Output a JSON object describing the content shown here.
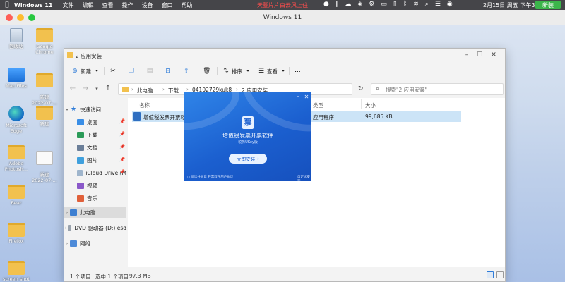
{
  "menubar": {
    "app_name": "Windows 11",
    "menus": [
      "文件",
      "编辑",
      "查看",
      "操作",
      "设备",
      "窗口",
      "帮助"
    ],
    "marquee": "天翻片片白云风上住",
    "clock": "2月15日 周五 下午3:08",
    "new_button": "新装",
    "colors": {
      "marquee": "#ff4d4d",
      "new_button": "#3bb54a"
    }
  },
  "vm_window": {
    "title": "Windows 11"
  },
  "desktop_icons": [
    {
      "label": "回收站",
      "icon": "recycle-bin-icon"
    },
    {
      "label": "Google Chrome",
      "icon": "folder-icon"
    },
    {
      "label": "Mac Files",
      "icon": "mac-files-icon"
    },
    {
      "label": "新建\n2022-07-...",
      "icon": "folder-icon"
    },
    {
      "label": "Microsoft Edge",
      "icon": "edge-icon"
    },
    {
      "label": "新建",
      "icon": "folder-icon"
    },
    {
      "label": "Adobe Photosh...",
      "icon": "folder-icon"
    },
    {
      "label": "新建\n2022-07-...",
      "icon": "document-icon"
    },
    {
      "label": "Bear",
      "icon": "folder-icon"
    },
    {
      "label": "Firefox",
      "icon": "folder-icon"
    },
    {
      "label": "screen shot",
      "icon": "folder-icon"
    }
  ],
  "explorer": {
    "title": "2 应用安装",
    "toolbar": {
      "new_label": "新建",
      "sort_label": "排序",
      "view_label": "查看",
      "more_label": "···"
    },
    "address": {
      "crumbs": [
        "此电脑",
        "下载",
        "04102729kuk8",
        "2 应用安装"
      ],
      "search_placeholder": "搜索\"2 应用安装\""
    },
    "sidebar": [
      {
        "label": "快速访问",
        "icon": "star-icon",
        "expand": "▾"
      },
      {
        "label": "桌面",
        "icon": "desktop-folder-icon",
        "pinned": true
      },
      {
        "label": "下载",
        "icon": "downloads-folder-icon",
        "pinned": true
      },
      {
        "label": "文档",
        "icon": "documents-folder-icon",
        "pinned": true
      },
      {
        "label": "图片",
        "icon": "pictures-folder-icon",
        "pinned": true
      },
      {
        "label": "iCloud Drive (M",
        "icon": "icloud-icon",
        "pinned": true
      },
      {
        "label": "视频",
        "icon": "videos-folder-icon"
      },
      {
        "label": "音乐",
        "icon": "music-folder-icon"
      },
      {
        "label": "此电脑",
        "icon": "this-pc-icon",
        "expand": "›",
        "selected": true
      },
      {
        "label": "DVD 驱动器 (D:) esd",
        "icon": "dvd-drive-icon",
        "expand": "›"
      },
      {
        "label": "网络",
        "icon": "network-icon",
        "expand": "›"
      }
    ],
    "columns": {
      "name": "名称",
      "type": "类型",
      "size": "大小"
    },
    "files": [
      {
        "name": "增值税发票开票软件",
        "type": "应用程序",
        "size": "99,685 KB"
      }
    ],
    "status": {
      "count": "1 个项目",
      "selected": "选中 1 个项目",
      "size": "97.3 MB"
    }
  },
  "installer": {
    "logo_glyph": "票",
    "app_name": "增值税发票开票软件",
    "version": "税务UKey版",
    "install_button": "立即安装",
    "agree_text": "○ 阅读并同意  开票软件用户协议",
    "custom_text": "自定义安装",
    "colors": {
      "background": "#1b5fcf",
      "button": "#e9f2ff"
    }
  }
}
